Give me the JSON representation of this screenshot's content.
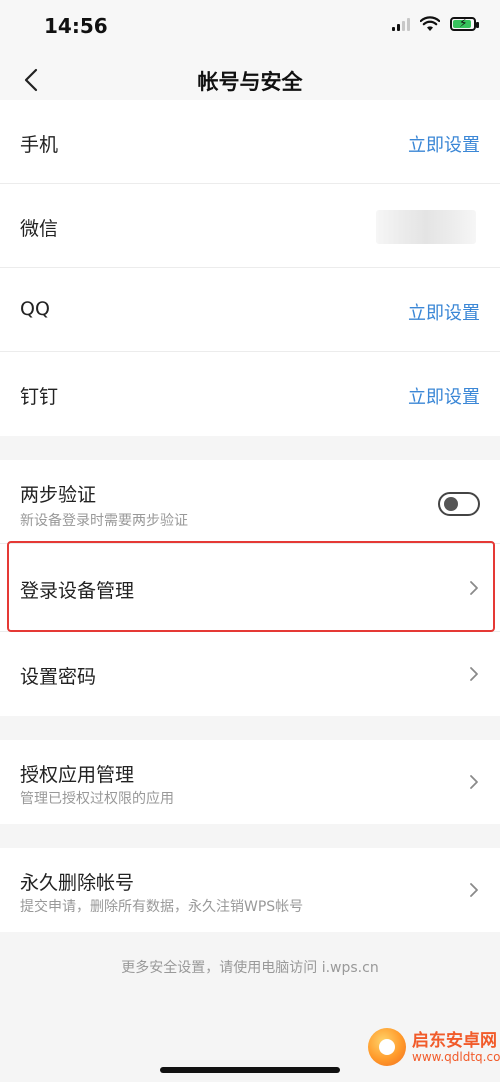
{
  "status_bar": {
    "time": "14:56",
    "icons": [
      "signal-icon",
      "wifi-icon",
      "battery-charging-icon"
    ]
  },
  "nav": {
    "title": "帐号与安全",
    "back_icon": "chevron-left-icon"
  },
  "rows": {
    "phone": {
      "label": "手机",
      "action": "立即设置"
    },
    "wechat": {
      "label": "微信"
    },
    "qq": {
      "label": "QQ",
      "action": "立即设置"
    },
    "dingtalk": {
      "label": "钉钉",
      "action": "立即设置"
    },
    "two_step": {
      "label": "两步验证",
      "subtitle": "新设备登录时需要两步验证"
    },
    "login_devices": {
      "label": "登录设备管理"
    },
    "set_password": {
      "label": "设置密码"
    },
    "authorized_apps": {
      "label": "授权应用管理",
      "subtitle": "管理已授权过权限的应用"
    },
    "delete_account": {
      "label": "永久删除帐号",
      "subtitle": "提交申请，删除所有数据，永久注销WPS帐号"
    }
  },
  "footer": {
    "text": "更多安全设置，请使用电脑访问 i.wps.cn"
  },
  "watermark": {
    "title": "启东安卓网",
    "url": "www.qdldtq.com"
  },
  "colors": {
    "accent": "#3b87d6",
    "highlight": "#e53935",
    "background": "#f5f5f5"
  }
}
